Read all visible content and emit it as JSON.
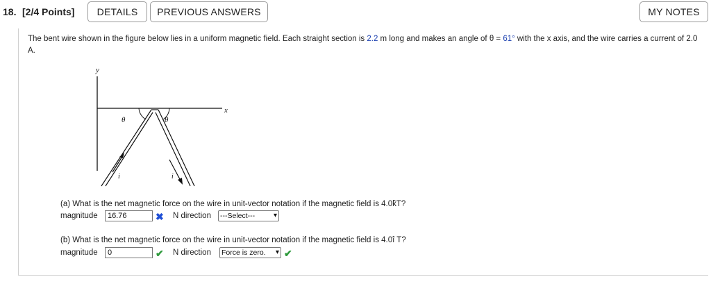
{
  "header": {
    "question_number": "18.",
    "points": "[2/4 Points]",
    "details_label": "DETAILS",
    "previous_answers_label": "PREVIOUS ANSWERS",
    "my_notes_label": "MY NOTES"
  },
  "problem": {
    "text_1": "The bent wire shown in the figure below lies in a uniform magnetic field. Each straight section is ",
    "length_value": "2.2",
    "text_2": " m long and makes an angle of θ = ",
    "angle_value": "61°",
    "text_3": " with the x axis, and the wire carries a current of 2.0 A."
  },
  "figure": {
    "y_label": "y",
    "x_label": "x",
    "theta_left": "θ",
    "theta_right": "θ",
    "current_left": "i",
    "current_right": "i"
  },
  "part_a": {
    "question": "(a) What is the net magnetic force on the wire in unit-vector notation if the magnetic field is 4.0k̂T?",
    "magnitude_label": "magnitude",
    "magnitude_value": "16.76",
    "direction_label": "N direction",
    "direction_value": "---Select---",
    "status": "incorrect",
    "status_icon": "✖"
  },
  "part_b": {
    "question": "(b) What is the net magnetic force on the wire in unit-vector notation if the magnetic field is 4.0î T?",
    "magnitude_label": "magnitude",
    "magnitude_value": "0",
    "direction_label": "N direction",
    "direction_value": "Force is zero.",
    "status": "correct",
    "status_icon": "✔"
  },
  "colors": {
    "given_value": "#1a3fb0",
    "incorrect_mark": "#1f4fd6",
    "correct_mark": "#2e9a3c"
  }
}
